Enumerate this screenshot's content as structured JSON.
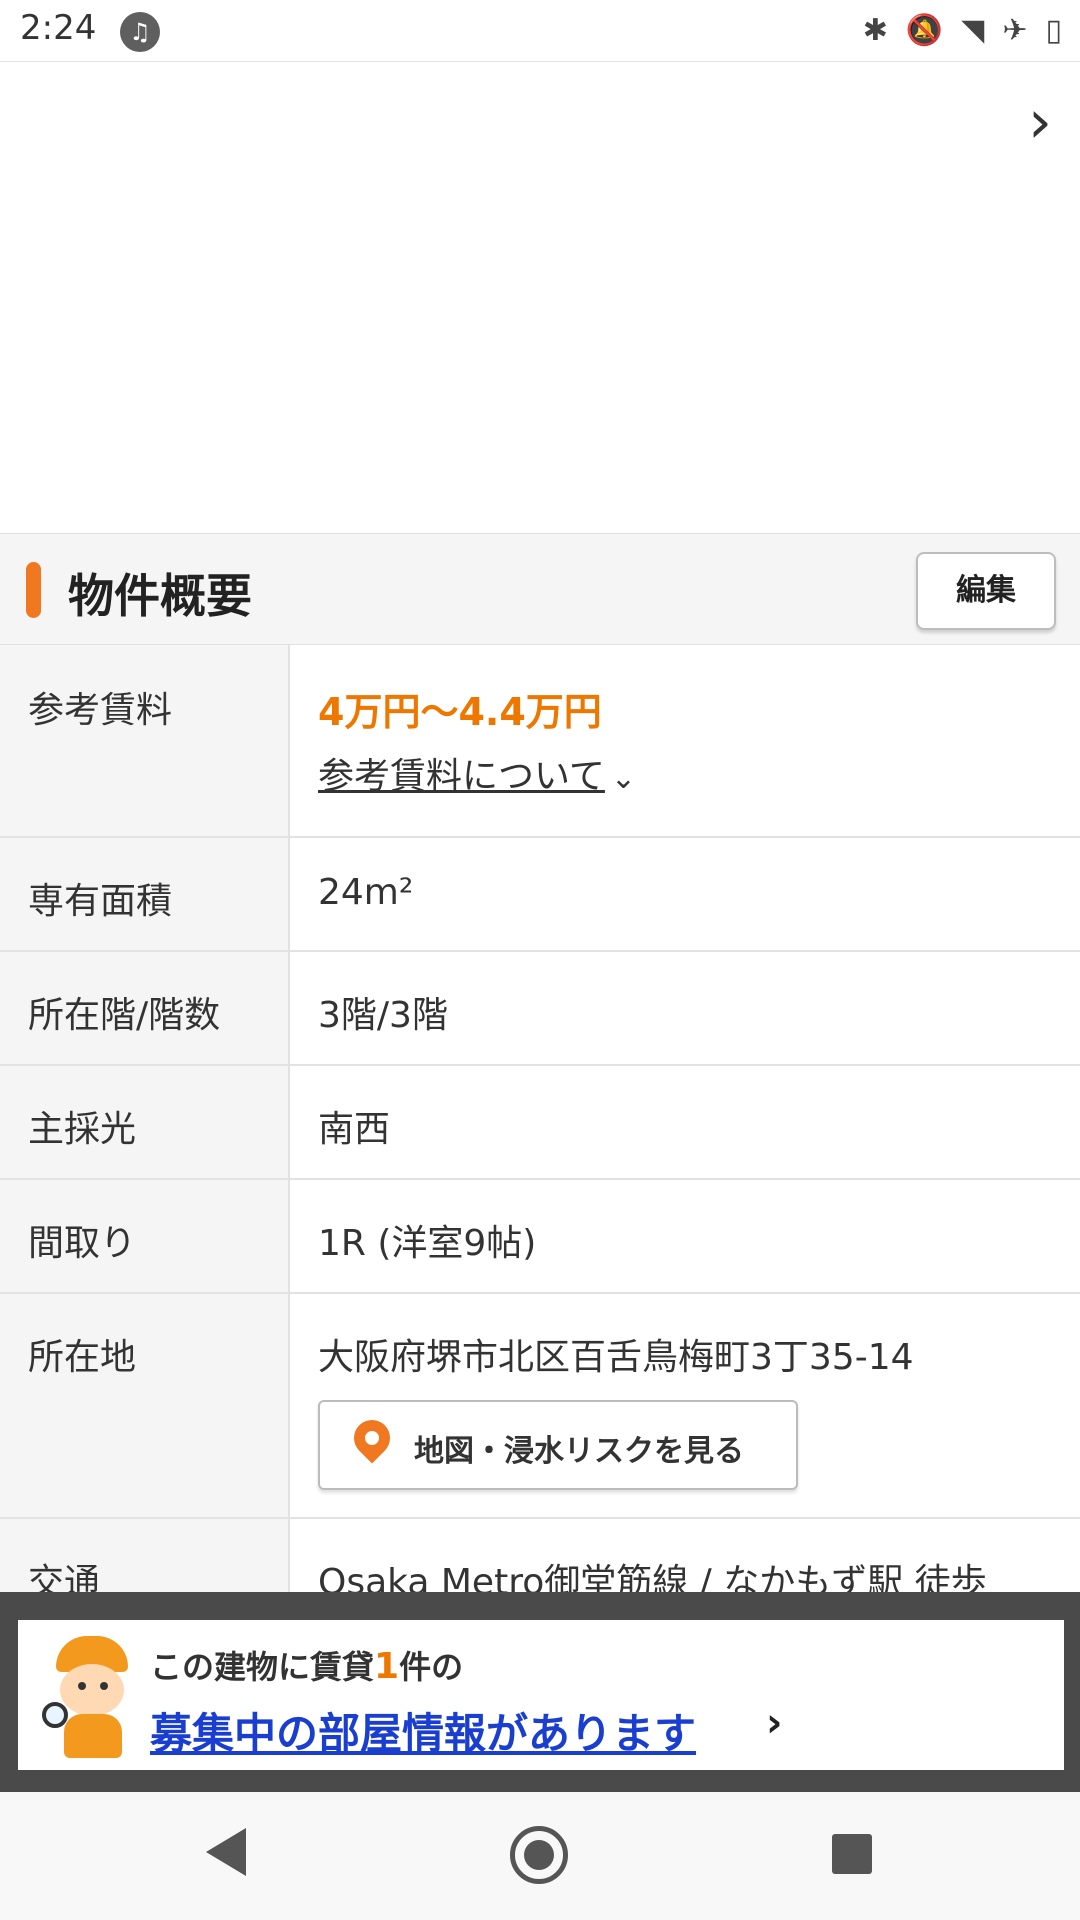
{
  "status_bar": {
    "time": "2:24",
    "icons": [
      "music-icon",
      "bluetooth-icon",
      "notifications-off-icon",
      "wifi-icon",
      "airplane-icon",
      "battery-icon"
    ]
  },
  "section": {
    "title": "物件概要",
    "edit_label": "編集"
  },
  "table": {
    "rent": {
      "label": "参考賃料",
      "value": "4万円〜4.4万円",
      "about_link": "参考賃料について"
    },
    "area": {
      "label": "専有面積",
      "value": "24m²"
    },
    "floor": {
      "label": "所在階/階数",
      "value": "3階/3階"
    },
    "light": {
      "label": "主採光",
      "value": "南西"
    },
    "layout": {
      "label": "間取り",
      "value": "1R (洋室9帖)"
    },
    "address": {
      "label": "所在地",
      "value": "大阪府堺市北区百舌鳥梅町3丁35-14",
      "map_button": "地図・浸水リスクを見る"
    },
    "transit": {
      "label": "交通",
      "value": "Osaka Metro御堂筋線 / なかもず駅 徒歩"
    }
  },
  "banner": {
    "line1_prefix": "この建物に賃貸",
    "count": "1",
    "line1_suffix": "件の",
    "link_text": "募集中の部屋情報があります",
    "arrow": "›"
  },
  "colors": {
    "accent": "#ee7700",
    "link": "#1a3fd0",
    "label_bg": "#f5f5f5"
  }
}
